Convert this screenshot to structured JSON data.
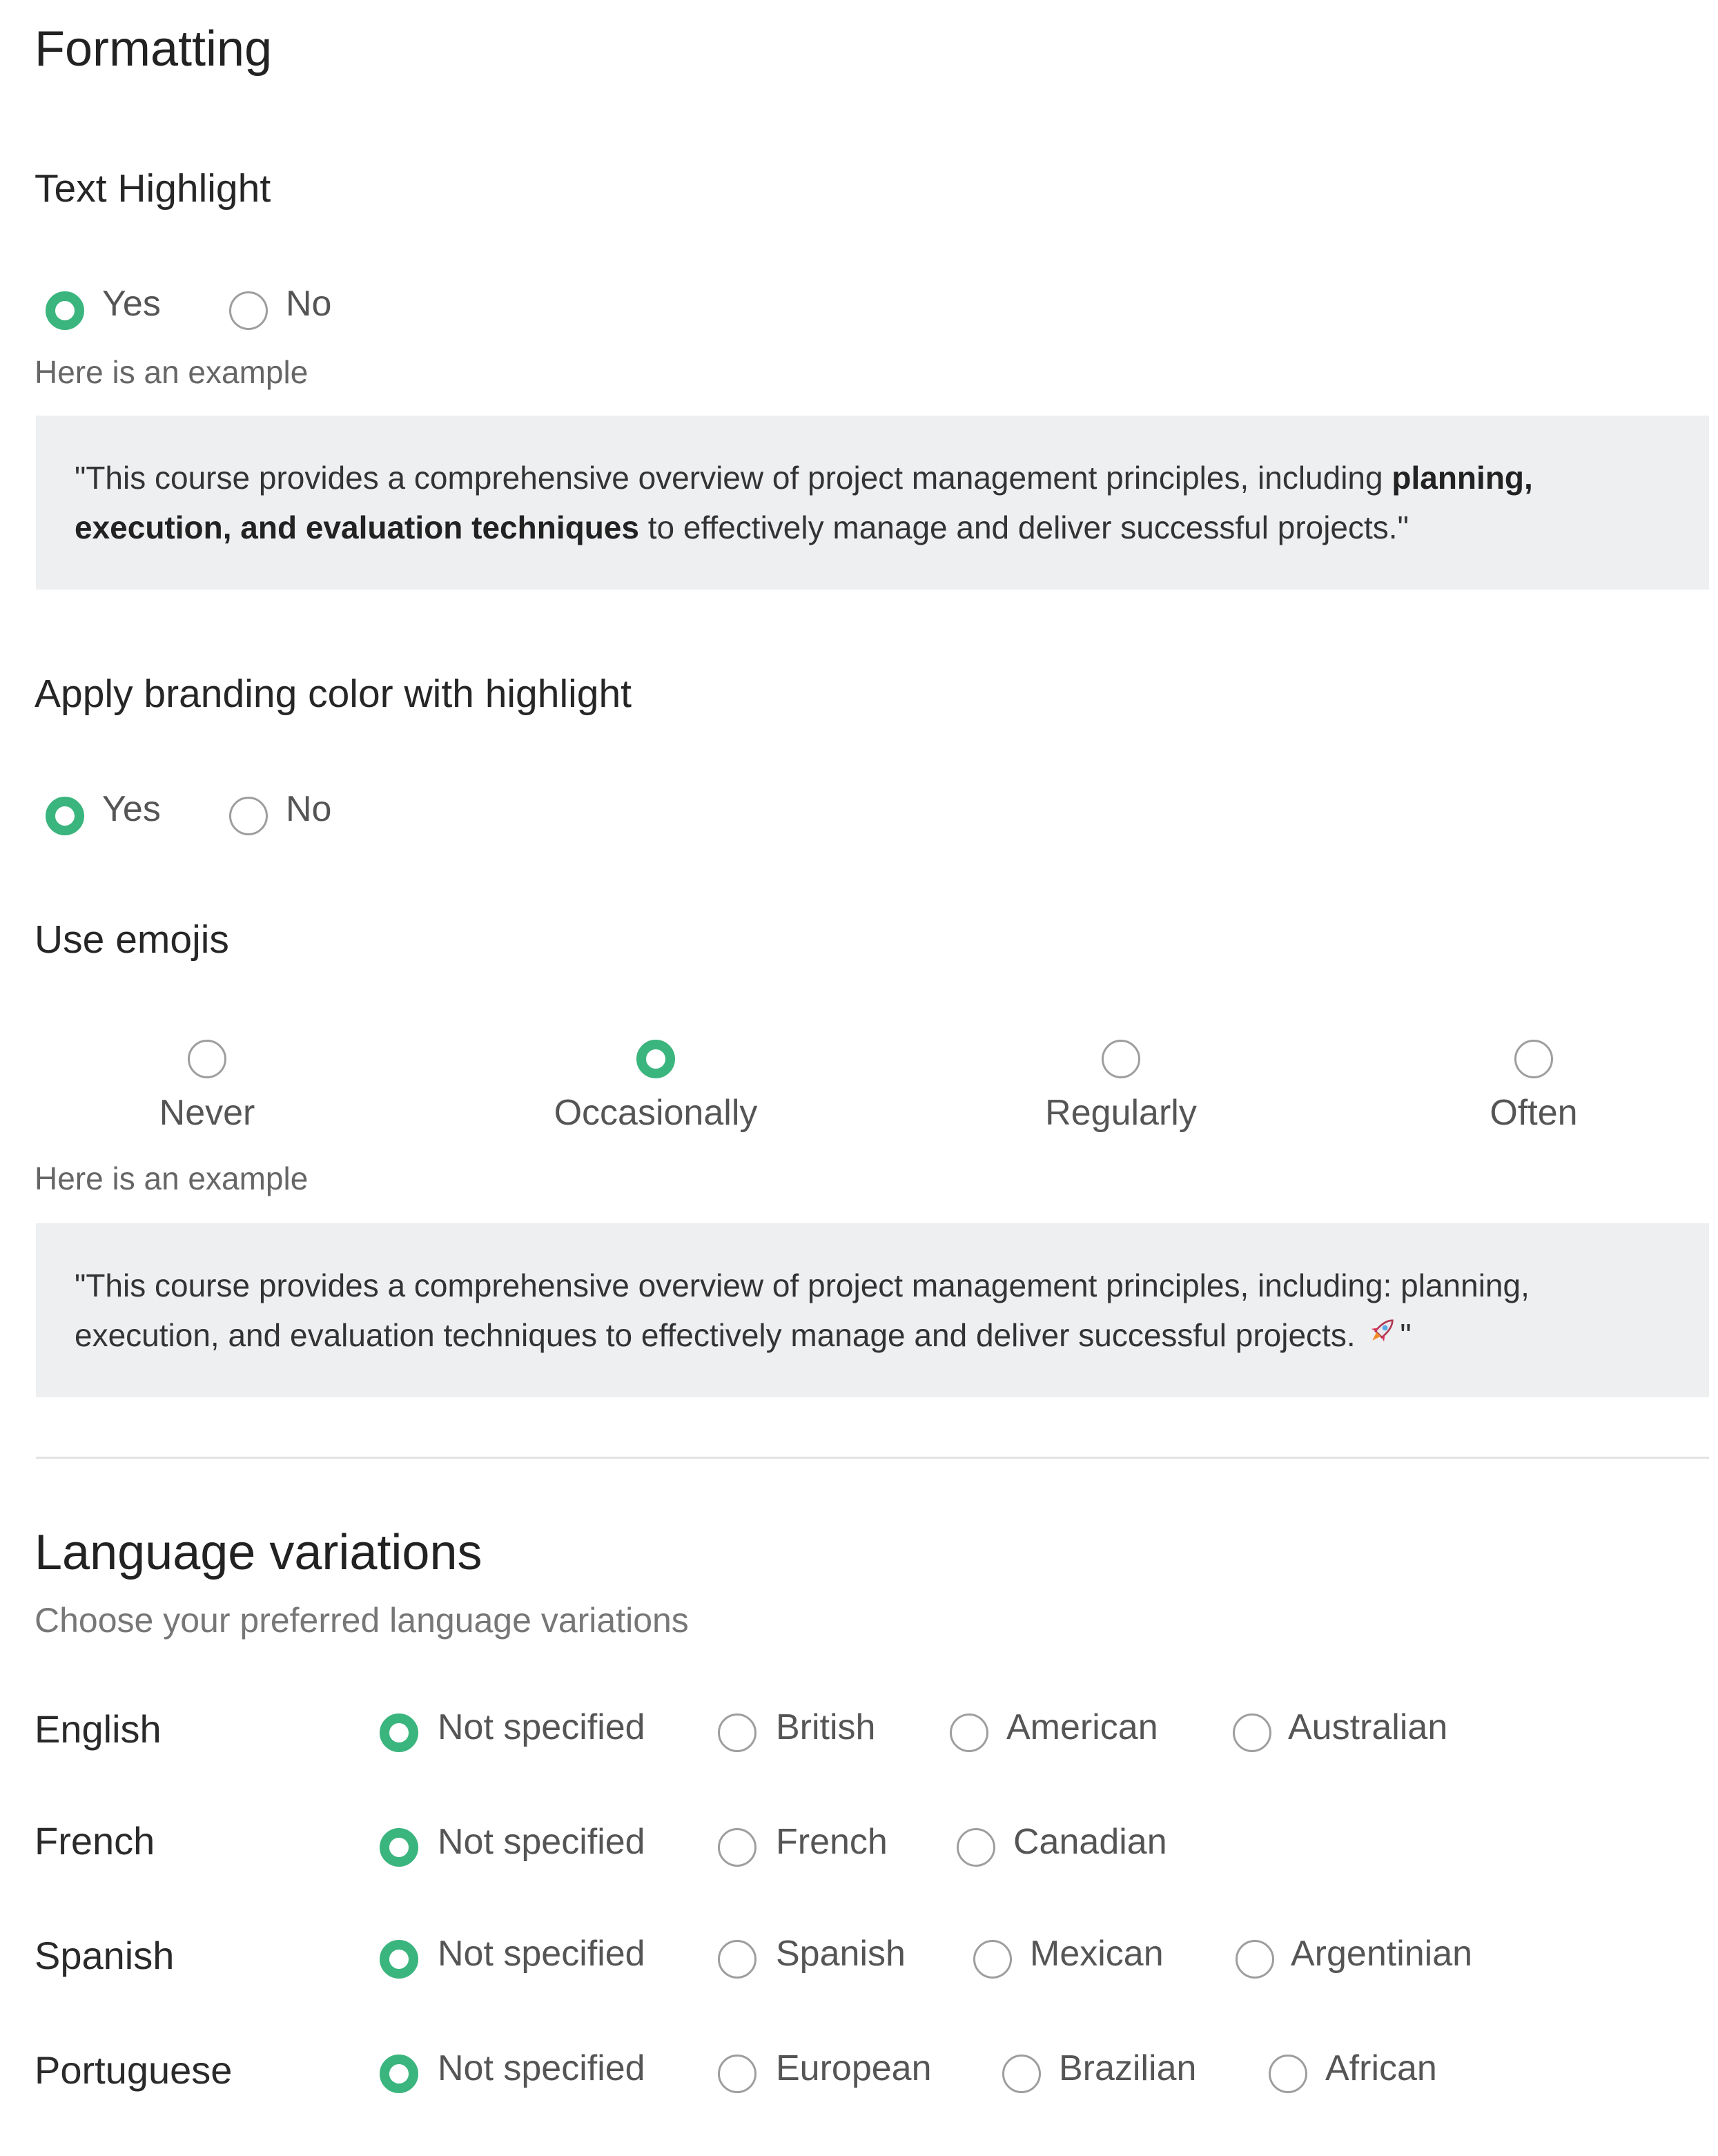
{
  "formatting": {
    "title": "Formatting",
    "text_highlight": {
      "label": "Text Highlight",
      "options": [
        "Yes",
        "No"
      ],
      "selected": "Yes",
      "example_label": "Here is an example",
      "example": {
        "before": "\"This course provides a comprehensive overview of project management principles, including ",
        "bold": "planning, execution, and evaluation techniques",
        "after": " to effectively manage and deliver successful projects.\""
      }
    },
    "branding": {
      "label": "Apply branding color with highlight",
      "options": [
        "Yes",
        "No"
      ],
      "selected": "Yes"
    },
    "emojis": {
      "label": "Use emojis",
      "options": [
        "Never",
        "Occasionally",
        "Regularly",
        "Often"
      ],
      "selected": "Occasionally",
      "example_label": "Here is an example",
      "example": {
        "text": "\"This course provides a comprehensive overview of project management principles, including: planning, execution, and evaluation techniques to effectively manage and deliver successful projects. ",
        "emoji": "rocket-icon",
        "closing": "\""
      }
    }
  },
  "language_variations": {
    "title": "Language variations",
    "subtitle": "Choose your preferred language variations",
    "languages": [
      {
        "name": "English",
        "options": [
          "Not specified",
          "British",
          "American",
          "Australian"
        ],
        "selected": "Not specified"
      },
      {
        "name": "French",
        "options": [
          "Not specified",
          "French",
          "Canadian"
        ],
        "selected": "Not specified"
      },
      {
        "name": "Spanish",
        "options": [
          "Not specified",
          "Spanish",
          "Mexican",
          "Argentinian"
        ],
        "selected": "Not specified"
      },
      {
        "name": "Portuguese",
        "options": [
          "Not specified",
          "European",
          "Brazilian",
          "African"
        ],
        "selected": "Not specified"
      }
    ]
  },
  "colors": {
    "accent": "#3bb57e",
    "example_background": "#eeeff1"
  }
}
